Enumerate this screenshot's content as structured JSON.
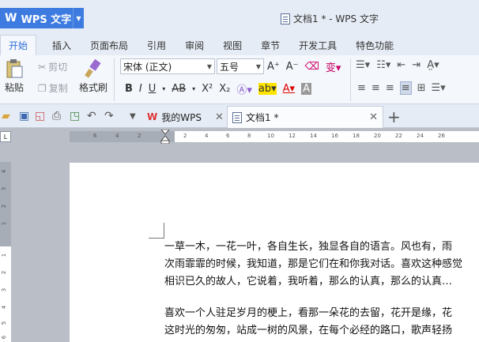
{
  "app": {
    "name": "WPS 文字",
    "logo": "W"
  },
  "window": {
    "title": "文档1 * - WPS 文字"
  },
  "menu": [
    "开始",
    "插入",
    "页面布局",
    "引用",
    "审阅",
    "视图",
    "章节",
    "开发工具",
    "特色功能"
  ],
  "ribbon": {
    "paste": "粘贴",
    "cut": "剪切",
    "copy": "复制",
    "format_painter": "格式刷",
    "font": "宋体 (正文)",
    "size": "五号"
  },
  "tabs": {
    "mywps": "我的WPS",
    "doc": "文档1 *"
  },
  "ruler": {
    "h_ticks": [
      "6",
      "4",
      "2",
      "2",
      "4",
      "6",
      "8",
      "10",
      "12",
      "14",
      "16",
      "18",
      "20",
      "22",
      "24",
      "26"
    ],
    "v_ticks": [
      "4",
      "3",
      "2",
      "1",
      "1",
      "2",
      "3",
      "4",
      "5",
      "6"
    ]
  },
  "document": {
    "lines": [
      "一草一木，一花一叶，各自生长，独显各自的语言。风也有，雨",
      "次雨霏霏的时候，我知道，那是它们在和你我对话。喜欢这种感觉",
      "相识已久的故人，它说着，我听着，那么的认真，那么的认真…",
      "",
      "喜欢一个人驻足岁月的梗上，看那一朵花的去留，花开是缘，花",
      "这时光的匆匆，站成一树的风景，在每个必经的路口，歌声轻扬"
    ]
  },
  "colors": {
    "accent": "#3d7be0",
    "chrome": "#e6ecf5",
    "ribbon": "#f4f7fb"
  }
}
